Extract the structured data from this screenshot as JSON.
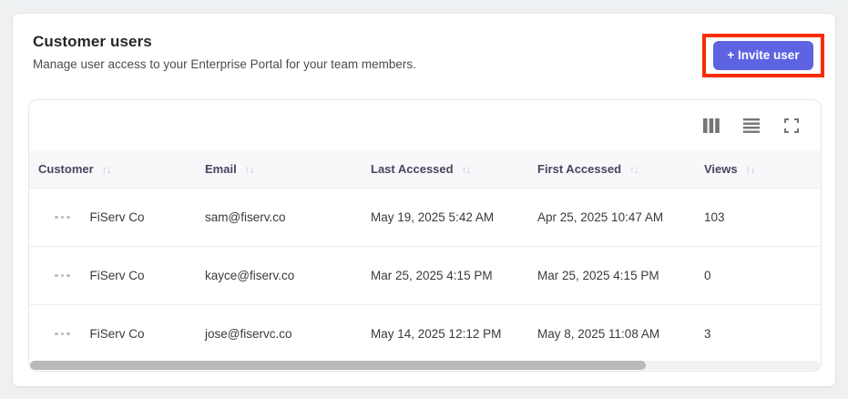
{
  "header": {
    "title": "Customer users",
    "subtitle": "Manage user access to your Enterprise Portal for your team members."
  },
  "invite_button": {
    "label": "+ Invite user",
    "accent_color": "#5d63e1",
    "annotation_highlight_color": "#f82d02"
  },
  "toolbar": {
    "icons": [
      "columns-icon",
      "row-density-icon",
      "fullscreen-icon"
    ],
    "icon_color": "#757575"
  },
  "table": {
    "sort_glyph": "↑↓",
    "columns": [
      {
        "label": "Customer",
        "sortable": true
      },
      {
        "label": "Email",
        "sortable": true
      },
      {
        "label": "Last Accessed",
        "sortable": true
      },
      {
        "label": "First Accessed",
        "sortable": true
      },
      {
        "label": "Views",
        "sortable": true
      }
    ],
    "rows": [
      {
        "customer": "FiServ Co",
        "email": "sam@fiserv.co",
        "last_accessed": "May 19, 2025 5:42 AM",
        "first_accessed": "Apr 25, 2025 10:47 AM",
        "views": "103"
      },
      {
        "customer": "FiServ Co",
        "email": "kayce@fiserv.co",
        "last_accessed": "Mar 25, 2025 4:15 PM",
        "first_accessed": "Mar 25, 2025 4:15 PM",
        "views": "0"
      },
      {
        "customer": "FiServ Co",
        "email": "jose@fiservc.co",
        "last_accessed": "May 14, 2025 12:12 PM",
        "first_accessed": "May 8, 2025 11:08 AM",
        "views": "3"
      }
    ],
    "scrollbar": {
      "thumb_style": "width:78%"
    },
    "header_bg": "#f8f8fb"
  }
}
